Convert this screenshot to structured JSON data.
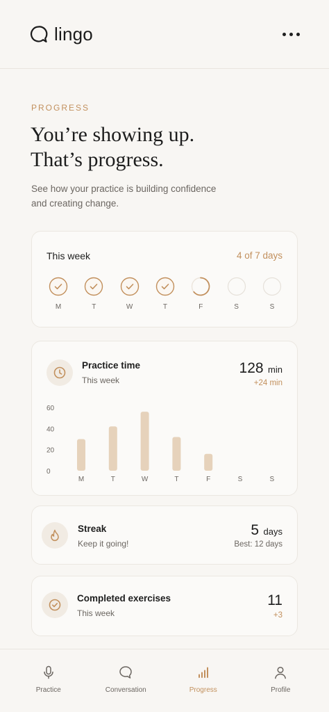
{
  "app": {
    "name": "lingo"
  },
  "page": {
    "eyebrow": "PROGRESS",
    "headline_line1": "You’re showing up.",
    "headline_line2": "That’s progress.",
    "subtitle_line1": "See how your practice is building confidence",
    "subtitle_line2": "and creating change."
  },
  "week": {
    "title": "This week",
    "count": "4 of 7 days",
    "days": [
      {
        "label": "M",
        "state": "done"
      },
      {
        "label": "T",
        "state": "done"
      },
      {
        "label": "W",
        "state": "done"
      },
      {
        "label": "T",
        "state": "done"
      },
      {
        "label": "F",
        "state": "partial"
      },
      {
        "label": "S",
        "state": "empty"
      },
      {
        "label": "S",
        "state": "empty"
      }
    ]
  },
  "practice": {
    "icon": "clock-icon",
    "title": "Practice time",
    "subtitle": "This week",
    "value": "128",
    "unit": "min",
    "delta": "+24 min"
  },
  "chart_data": {
    "type": "bar",
    "categories": [
      "M",
      "T",
      "W",
      "T",
      "F",
      "S",
      "S"
    ],
    "values": [
      30,
      42,
      56,
      32,
      16,
      0,
      0
    ],
    "y_ticks": [
      "60",
      "40",
      "20",
      "0"
    ],
    "ylim": [
      0,
      60
    ],
    "grid": false,
    "bar_color": "#e6d2bb"
  },
  "streak": {
    "icon": "flame-icon",
    "title": "Streak",
    "subtitle": "Keep it going!",
    "value": "5",
    "unit": "days",
    "best": "Best: 12 days"
  },
  "completed": {
    "icon": "check-circle-icon",
    "title": "Completed exercises",
    "subtitle": "This week",
    "value": "11",
    "delta": "+3"
  },
  "tabs": [
    {
      "label": "Practice",
      "icon": "microphone-icon",
      "active": false
    },
    {
      "label": "Conversation",
      "icon": "chat-bubble-icon",
      "active": false
    },
    {
      "label": "Progress",
      "icon": "bar-chart-icon",
      "active": true
    },
    {
      "label": "Profile",
      "icon": "person-icon",
      "active": false
    }
  ],
  "colors": {
    "accent": "#c2905d",
    "background": "#f8f6f3",
    "card": "#fbfaf8",
    "bar": "#e6d2bb"
  }
}
